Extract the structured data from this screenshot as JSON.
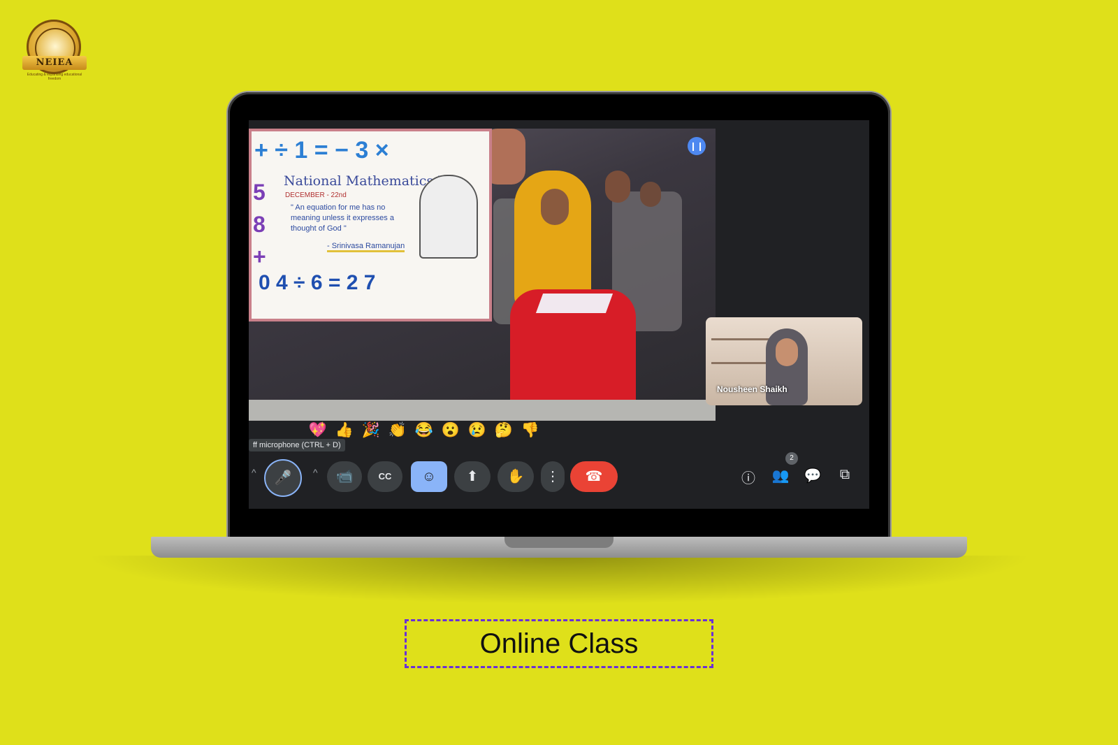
{
  "logo": {
    "text": "NEIEA",
    "tagline": "Educating & expanding educational freedom"
  },
  "meet": {
    "poster": {
      "title": "National Mathematics Day",
      "date": "DECEMBER - 22nd",
      "quote": "\" An equation for me has no meaning unless it expresses a thought of God \"",
      "signature": "- Srinivasa Ramanujan",
      "top_row": "+ ÷ 1 = − 3 ×",
      "bottom_row": "0 4 ÷ 6 = 2 7",
      "left_col": "5 8 +"
    },
    "self_view_name": "Nousheen Shaikh",
    "reactions": [
      "💖",
      "👍",
      "🎉",
      "👏",
      "😂",
      "😮",
      "😢",
      "🤔",
      "👎"
    ],
    "tooltip": "ff microphone (CTRL + D)",
    "participant_count": "2",
    "icons": {
      "mic": "🎤",
      "camera": "📹",
      "captions": "CC",
      "emoji": "☺",
      "present": "⬆",
      "raise_hand": "✋",
      "more": "⋮",
      "leave": "☎",
      "info": "ⓘ",
      "people": "👥",
      "chat": "💬",
      "activities": "⧉",
      "caret": "^"
    }
  },
  "caption": "Online Class"
}
